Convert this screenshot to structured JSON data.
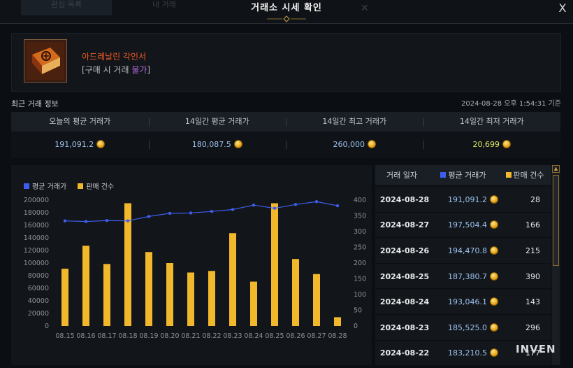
{
  "window": {
    "title": "거래소 시세 확인",
    "bg_tabs": [
      "관심 목록",
      "내 거래"
    ],
    "close_glyph": "X"
  },
  "item": {
    "name": "아드레날린 각인서",
    "trade_prefix": "[구매 시 거래 ",
    "trade_status": "불가",
    "trade_suffix": "]",
    "icon": "engraving-book-icon"
  },
  "recent": {
    "title": "최근 거래 정보",
    "timestamp": "2024-08-28 오후 1:54:31 기준"
  },
  "stats": [
    {
      "label": "오늘의 평균 거래가",
      "value": "191,091.2",
      "color": "#9ec2ee"
    },
    {
      "label": "14일간 평균 거래가",
      "value": "180,087.5",
      "color": "#9ec2ee"
    },
    {
      "label": "14일간 최고 거래가",
      "value": "260,000",
      "color": "#9ec2ee"
    },
    {
      "label": "14일간 최저 거래가",
      "value": "20,699",
      "color": "#e0e86a"
    }
  ],
  "chart_data": {
    "type": "bar",
    "categories": [
      "08.15",
      "08.16",
      "08.17",
      "08.18",
      "08.19",
      "08.20",
      "08.21",
      "08.22",
      "08.23",
      "08.24",
      "08.25",
      "08.26",
      "08.27",
      "08.28"
    ],
    "series": [
      {
        "name": "평균 거래가",
        "type": "line",
        "axis": "left",
        "color": "#3d5ef0",
        "values": [
          167000,
          166000,
          167500,
          167000,
          174000,
          179000,
          179500,
          182000,
          185000,
          192000,
          187000,
          193000,
          197500,
          191091.2
        ]
      },
      {
        "name": "판매 건수",
        "type": "bar",
        "axis": "right",
        "color": "#f2b82c",
        "values": [
          182,
          255,
          197,
          390,
          235,
          200,
          170,
          175,
          295,
          141,
          390,
          213,
          165,
          28
        ]
      }
    ],
    "y_left": {
      "ticks": [
        0,
        20000,
        40000,
        60000,
        80000,
        100000,
        120000,
        140000,
        160000,
        180000,
        200000
      ],
      "ylim": [
        0,
        200000
      ]
    },
    "y_right": {
      "ticks": [
        0,
        50,
        100,
        150,
        200,
        250,
        300,
        350,
        400
      ],
      "ylim": [
        0,
        400
      ]
    },
    "legend": "top-left",
    "grid": false
  },
  "list": {
    "headers": {
      "date": "거래 일자",
      "avg": "평균 거래가",
      "count": "판매 건수"
    },
    "header_colors": {
      "avg": "#3d5ef0",
      "count": "#f2b82c"
    },
    "rows": [
      {
        "date": "2024-08-28",
        "avg": "191,091.2",
        "count": "28"
      },
      {
        "date": "2024-08-27",
        "avg": "197,504.4",
        "count": "166"
      },
      {
        "date": "2024-08-26",
        "avg": "194,470.8",
        "count": "215"
      },
      {
        "date": "2024-08-25",
        "avg": "187,380.7",
        "count": "390"
      },
      {
        "date": "2024-08-24",
        "avg": "193,046.1",
        "count": "143"
      },
      {
        "date": "2024-08-23",
        "avg": "185,525.0",
        "count": "296"
      },
      {
        "date": "2024-08-22",
        "avg": "183,210.5",
        "count": "177"
      }
    ]
  },
  "watermark": "INVEN"
}
